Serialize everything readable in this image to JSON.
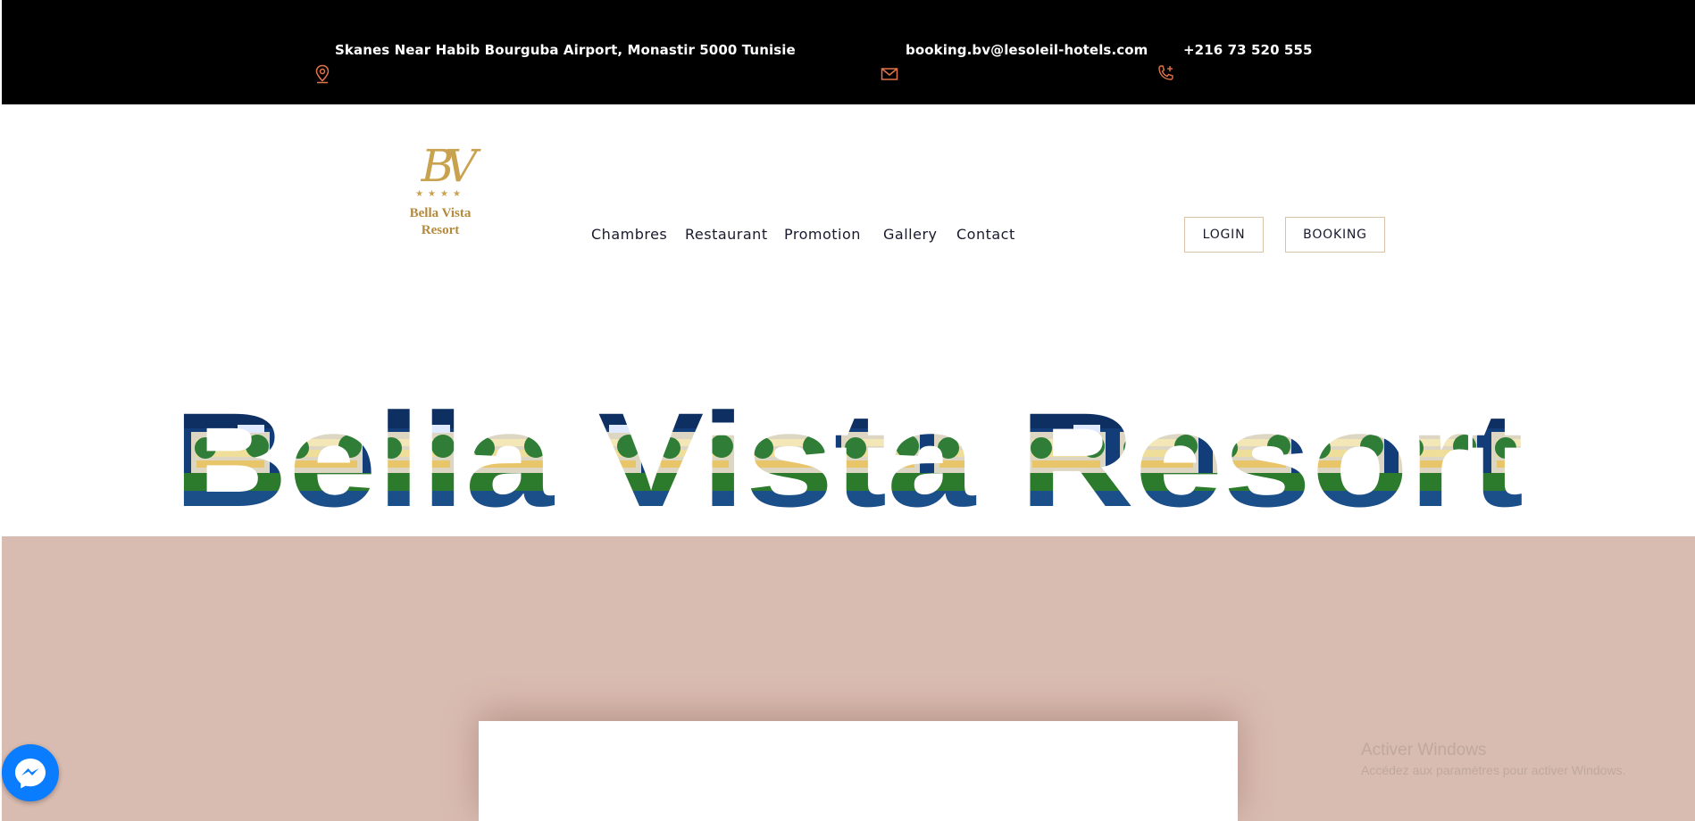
{
  "topbar": {
    "address": "Skanes Near Habib Bourguba Airport, Monastir 5000 Tunisie",
    "email": "booking.bv@lesoleil-hotels.com",
    "phone": "+216 73 520 555",
    "address_icon": "map-pin-icon",
    "email_icon": "envelope-icon",
    "phone_icon": "phone-plus-icon",
    "icon_color": "#e3744a"
  },
  "logo": {
    "monogram": "BV",
    "stars": "★★★★",
    "name_line1": "Bella Vista",
    "name_line2": "Resort",
    "color": "#c9a24f"
  },
  "nav": {
    "items": [
      "Chambres",
      "Restaurant",
      "Promotion",
      "Gallery",
      "Contact"
    ]
  },
  "header_buttons": {
    "login": "LOGIN",
    "booking": "BOOKING"
  },
  "hero": {
    "title": "Bella Vista Resort"
  },
  "messenger": {
    "icon": "messenger-icon",
    "color": "#0a7cff"
  },
  "windows_watermark": {
    "title": "Activer Windows",
    "subtitle": "Accédez aux paramètres pour activer Windows."
  }
}
